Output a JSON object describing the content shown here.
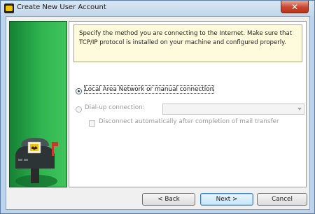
{
  "window": {
    "title": "Create New User Account",
    "close_symbol": "✕"
  },
  "info": {
    "text": "Specify the method you are connecting to the Internet. Make sure that TCP/IP protocol is installed on your machine and configured properly."
  },
  "options": {
    "lan_label": "Local Area Network or manual connection",
    "lan_selected": true,
    "dialup_label": "Dial-up connection:",
    "dialup_selected": false,
    "dialup_value": "",
    "disconnect_label": "Disconnect automatically after completion of mail transfer",
    "disconnect_checked": false
  },
  "buttons": {
    "back": "< Back",
    "next": "Next >",
    "cancel": "Cancel"
  },
  "icons": {
    "side_image": "mailbox-with-bat-letter-icon",
    "app": "bat-app-icon"
  }
}
